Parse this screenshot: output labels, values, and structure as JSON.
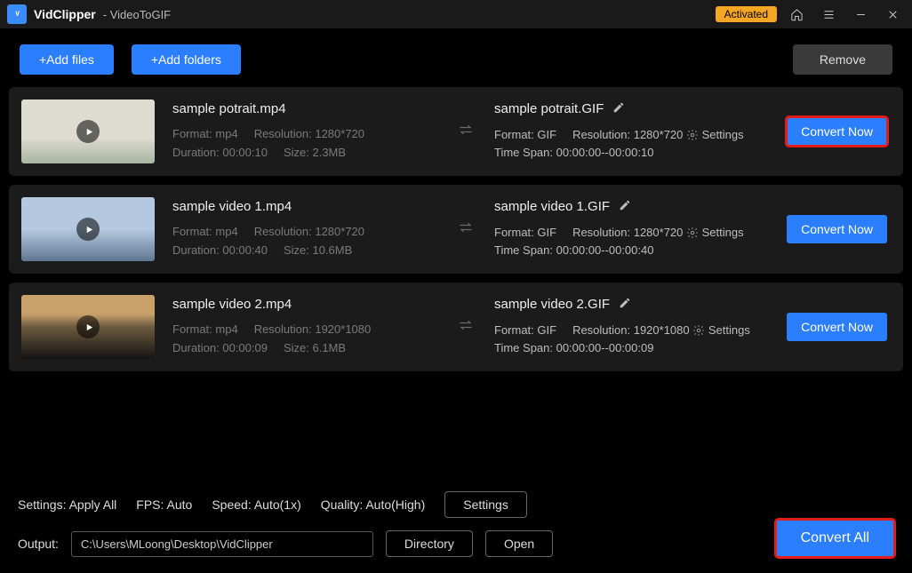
{
  "title": {
    "app": "VidClipper",
    "module": "VideoToGIF"
  },
  "badge": "Activated",
  "toolbar": {
    "add_files": "+Add files",
    "add_folders": "+Add folders",
    "remove": "Remove"
  },
  "labels": {
    "format": "Format:",
    "resolution": "Resolution:",
    "duration": "Duration:",
    "size": "Size:",
    "timespan": "Time Span:",
    "settings": "Settings",
    "convert_now": "Convert Now"
  },
  "items": [
    {
      "src_name": "sample potrait.mp4",
      "src_format": "mp4",
      "src_res": "1280*720",
      "src_dur": "00:00:10",
      "src_size": "2.3MB",
      "out_name": "sample potrait.GIF",
      "out_format": "GIF",
      "out_res": "1280*720",
      "out_timespan": "00:00:00--00:00:10",
      "highlight": true
    },
    {
      "src_name": "sample video 1.mp4",
      "src_format": "mp4",
      "src_res": "1280*720",
      "src_dur": "00:00:40",
      "src_size": "10.6MB",
      "out_name": "sample video 1.GIF",
      "out_format": "GIF",
      "out_res": "1280*720",
      "out_timespan": "00:00:00--00:00:40",
      "highlight": false
    },
    {
      "src_name": "sample video 2.mp4",
      "src_format": "mp4",
      "src_res": "1920*1080",
      "src_dur": "00:00:09",
      "src_size": "6.1MB",
      "out_name": "sample video 2.GIF",
      "out_format": "GIF",
      "out_res": "1920*1080",
      "out_timespan": "00:00:00--00:00:09",
      "highlight": false
    }
  ],
  "footer": {
    "apply_all": "Settings: Apply All",
    "fps": "FPS: Auto",
    "speed": "Speed: Auto(1x)",
    "quality": "Quality: Auto(High)",
    "settings_btn": "Settings",
    "output_label": "Output:",
    "output_path": "C:\\Users\\MLoong\\Desktop\\VidClipper",
    "directory": "Directory",
    "open": "Open",
    "convert_all": "Convert All"
  }
}
